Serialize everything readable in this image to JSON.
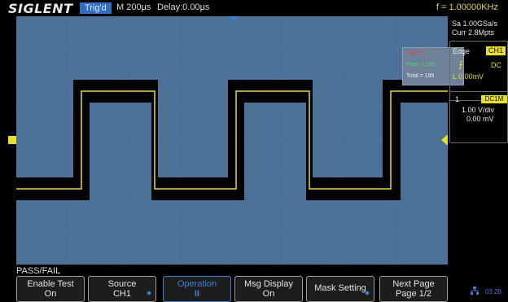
{
  "top": {
    "logo": "SIGLENT",
    "trig_status": "Trig'd",
    "timebase": "M 200µs",
    "delay": "Delay:0.00µs",
    "frequency": "f = 1.00000KHz"
  },
  "right_panel": {
    "sample_rate": "Sa 1.00GSa/s",
    "memory": "Curr 2.8Mpts",
    "trigger_type": "Edge",
    "trigger_source": "CH1",
    "coupling": "DC",
    "trigger_level": "L  0.00mV",
    "channel_number": "1",
    "channel_coupling": "DC1M",
    "volts_div": "1.00 V/div",
    "offset": "0.00 mV"
  },
  "passfail_stats": {
    "fail": "Fail = 0",
    "pass": "Pass = 195",
    "total": "Total = 195"
  },
  "menu": {
    "title": "PASS/FAIL",
    "buttons": [
      {
        "l1": "Enable Test",
        "l2": "On"
      },
      {
        "l1": "Source",
        "l2": "CH1"
      },
      {
        "l1": "Operation",
        "l2": "II"
      },
      {
        "l1": "Msg Display",
        "l2": "On"
      },
      {
        "l1": "Mask Setting",
        "l2": ""
      },
      {
        "l1": "Next Page",
        "l2": "Page 1/2"
      }
    ]
  },
  "clock": "03:28",
  "colors": {
    "screen": "#4b7296",
    "trace": "#e7df2a",
    "accent": "#3f7fd6",
    "fail": "#e04040",
    "pass": "#4fd06a"
  }
}
